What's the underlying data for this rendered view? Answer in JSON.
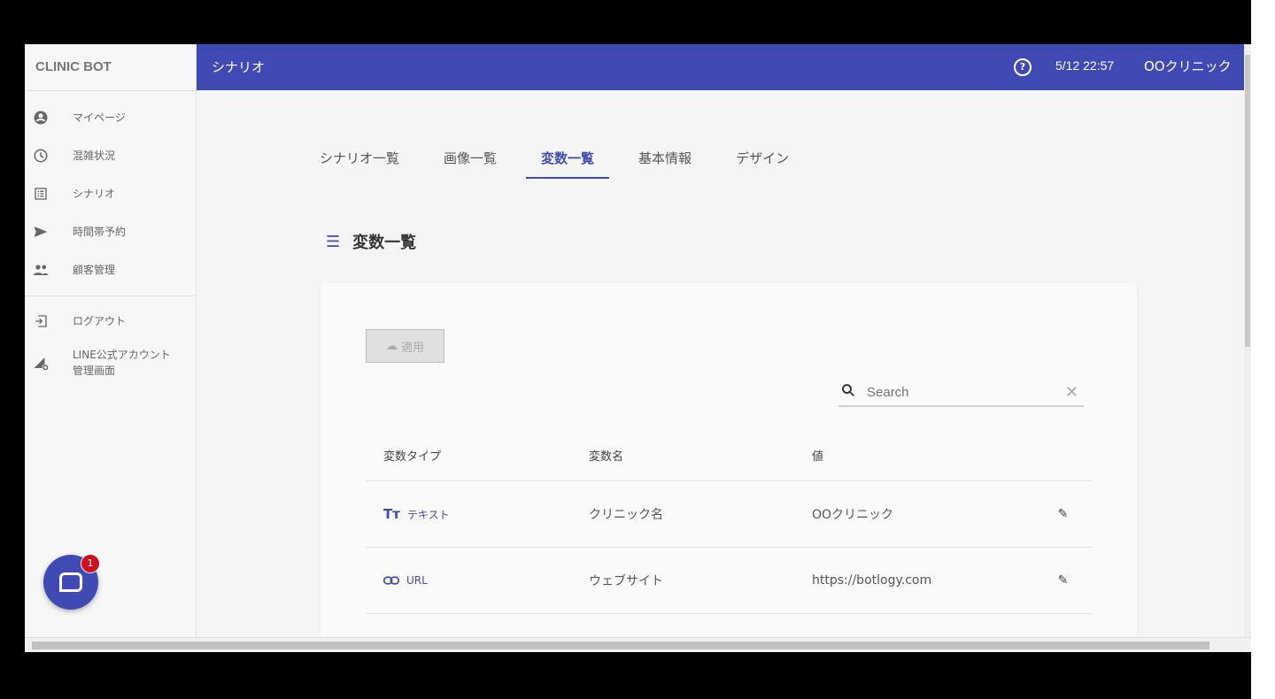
{
  "brand": "CLINIC BOT",
  "sidebar": {
    "items": [
      {
        "label": "マイページ",
        "icon": "account-circle-icon"
      },
      {
        "label": "混雑状況",
        "icon": "clock-icon"
      },
      {
        "label": "シナリオ",
        "icon": "list-icon"
      },
      {
        "label": "時間帯予約",
        "icon": "send-icon"
      },
      {
        "label": "顧客管理",
        "icon": "people-icon"
      }
    ],
    "logout": "ログアウト",
    "line_admin": [
      "LINE公式アカウント",
      "管理画面"
    ]
  },
  "header": {
    "title": "シナリオ",
    "time": "5/12 22:57",
    "clinic": "OOクリニック"
  },
  "tabs": [
    {
      "label": "シナリオ一覧"
    },
    {
      "label": "画像一覧"
    },
    {
      "label": "変数一覧",
      "active": true
    },
    {
      "label": "基本情報"
    },
    {
      "label": "デザイン"
    }
  ],
  "section_title": "変数一覧",
  "apply_label": "適用",
  "search": {
    "placeholder": "Search",
    "value": ""
  },
  "table": {
    "headers": [
      "変数タイプ",
      "変数名",
      "値"
    ],
    "rows": [
      {
        "type": "テキスト",
        "name": "クリニック名",
        "value": "OOクリニック"
      },
      {
        "type": "URL",
        "name": "ウェブサイト",
        "value": "https://botlogy.com"
      }
    ]
  },
  "chat": {
    "badge": "1"
  },
  "colors": {
    "primary": "#3f4ab5",
    "badge": "#d0101c"
  }
}
